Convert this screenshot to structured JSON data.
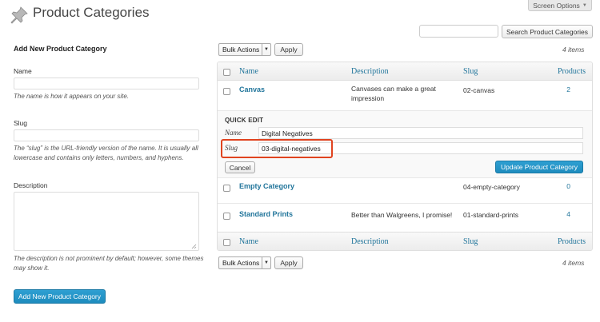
{
  "header": {
    "title": "Product Categories",
    "screen_options": "Screen Options",
    "search_button": "Search Product Categories"
  },
  "form": {
    "heading": "Add New Product Category",
    "name_label": "Name",
    "name_help": "The name is how it appears on your site.",
    "slug_label": "Slug",
    "slug_help": "The “slug” is the URL-friendly version of the name. It is usually all lowercase and contains only letters, numbers, and hyphens.",
    "description_label": "Description",
    "description_help": "The description is not prominent by default; however, some themes may show it.",
    "submit": "Add New Product Category"
  },
  "bulk": {
    "label": "Bulk Actions",
    "apply": "Apply",
    "items_count": "4 items"
  },
  "table": {
    "columns": {
      "name": "Name",
      "description": "Description",
      "slug": "Slug",
      "products": "Products"
    },
    "rows": [
      {
        "name": "Canvas",
        "description": "Canvases can make a great impression",
        "slug": "02-canvas",
        "count": "2"
      },
      {
        "name": "Empty Category",
        "description": "",
        "slug": "04-empty-category",
        "count": "0"
      },
      {
        "name": "Standard Prints",
        "description": "Better than Walgreens, I promise!",
        "slug": "01-standard-prints",
        "count": "4"
      }
    ]
  },
  "quick_edit": {
    "title": "QUICK EDIT",
    "name_label": "Name",
    "name_value": "Digital Negatives",
    "slug_label": "Slug",
    "slug_value": "03-digital-negatives",
    "cancel": "Cancel",
    "update": "Update Product Category"
  },
  "colors": {
    "link": "#21759b",
    "primary_button": "#1e8cbe",
    "highlight": "#e0431f"
  }
}
